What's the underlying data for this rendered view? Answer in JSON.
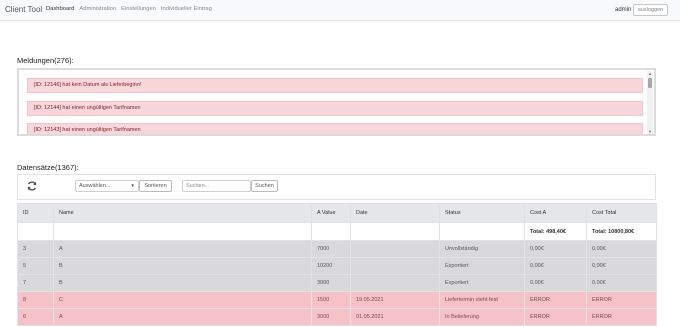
{
  "app": {
    "title": "Client Tool"
  },
  "nav": {
    "items": [
      "Dashboard",
      "Administration",
      "Einstellungen",
      "Individueller Eintrag"
    ]
  },
  "user": {
    "name": "admin",
    "logout_label": "ausloggen"
  },
  "messages": {
    "heading": "Meldungen(276):",
    "items": [
      "[ID: 12146] hat kein Datum als Lieferbeginn!",
      "[ID: 12144] hat einen ungültigen Tarifnamen",
      "[ID: 12143] hat einen ungültigen Tarifnamen"
    ]
  },
  "records": {
    "heading": "Datensätze(1367):",
    "select_placeholder": "Auswählen...",
    "sort_label": "Sortieren",
    "search_placeholder": "Suchen...",
    "search_label": "Suchen",
    "columns": [
      "ID",
      "Name",
      "A Value",
      "Date",
      "Status",
      "Cost A",
      "Cost Total"
    ],
    "totals": {
      "cost_a": "Total: 498,40€",
      "cost_total": "Total: 10800,80€"
    },
    "rows": [
      [
        "3",
        "A",
        "7000",
        "",
        "Unvollständig",
        "0,00€",
        "0,00€"
      ],
      [
        "5",
        "B",
        "10200",
        "",
        "Exportiert",
        "0,00€",
        "0,00€"
      ],
      [
        "7",
        "B",
        "3000",
        "",
        "Exportiert",
        "0,00€",
        "0,00€"
      ],
      [
        "8",
        "C",
        "1500",
        "19.05.2021",
        "Liefertermin steht fest",
        "ERROR",
        "ERROR"
      ],
      [
        "6",
        "A",
        "3000",
        "01.05.2021",
        "In Belieferung",
        "ERROR",
        "ERROR"
      ]
    ]
  },
  "colors": {
    "row_grey": "#d9d9dc",
    "row_error": "#f5c2c7",
    "message_bg": "#f8d7da"
  }
}
